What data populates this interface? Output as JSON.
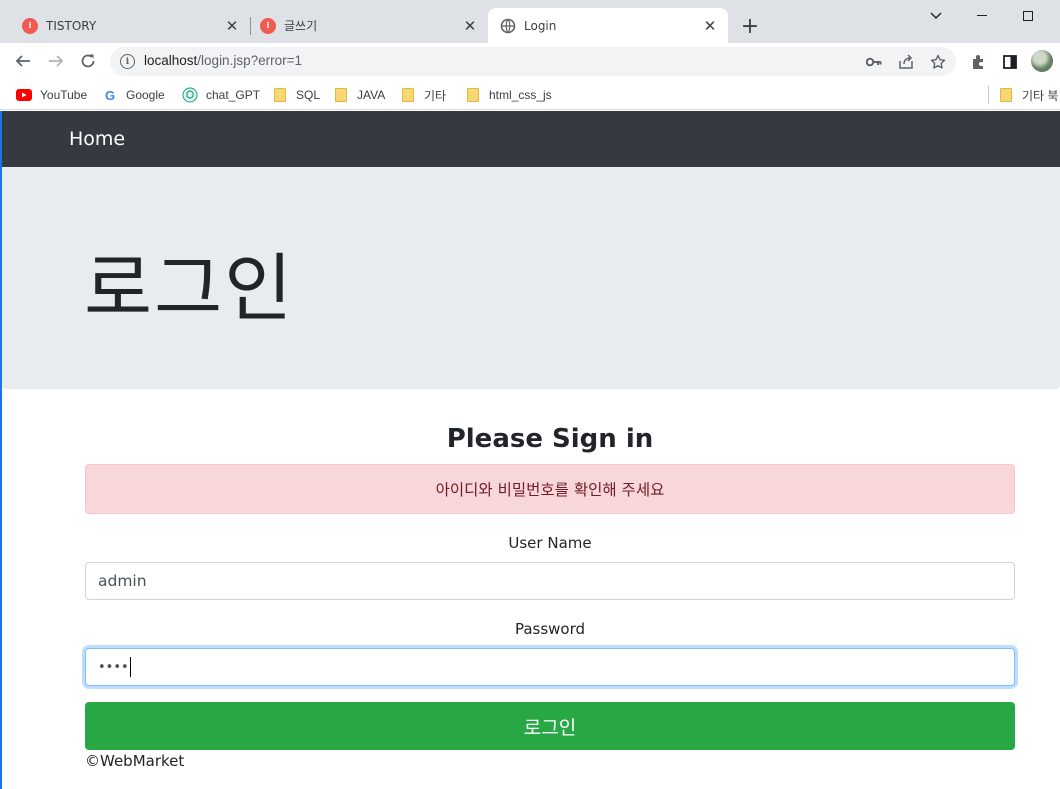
{
  "browser": {
    "tabs": [
      {
        "title": "TISTORY",
        "icon": "tistory-icon"
      },
      {
        "title": "글쓰기",
        "icon": "tistory-icon"
      },
      {
        "title": "Login",
        "icon": "globe-icon",
        "active": true
      }
    ],
    "url_host": "localhost",
    "url_path": "/login.jsp?error=1",
    "bookmarks": [
      {
        "label": "YouTube",
        "icon": "youtube-icon"
      },
      {
        "label": "Google",
        "icon": "google-icon"
      },
      {
        "label": "chat_GPT",
        "icon": "openai-icon"
      },
      {
        "label": "SQL",
        "icon": "folder-icon"
      },
      {
        "label": "JAVA",
        "icon": "folder-icon"
      },
      {
        "label": "기타",
        "icon": "folder-icon"
      },
      {
        "label": "html_css_js",
        "icon": "folder-icon"
      }
    ],
    "other_bookmarks_label": "기타 북"
  },
  "navbar": {
    "brand": "Home"
  },
  "jumbotron": {
    "title": "로그인"
  },
  "login": {
    "heading": "Please Sign in",
    "error_message": "아이디와 비밀번호를 확인해 주세요",
    "username_label": "User Name",
    "username_value": "admin",
    "password_label": "Password",
    "password_value": "••••",
    "submit_label": "로그인"
  },
  "footer": {
    "text": "©WebMarket"
  },
  "colors": {
    "navbar": "#343a40",
    "jumbotron": "#e9ecef",
    "alert_bg": "#f8d7da",
    "alert_text": "#721c24",
    "button": "#28a745"
  }
}
